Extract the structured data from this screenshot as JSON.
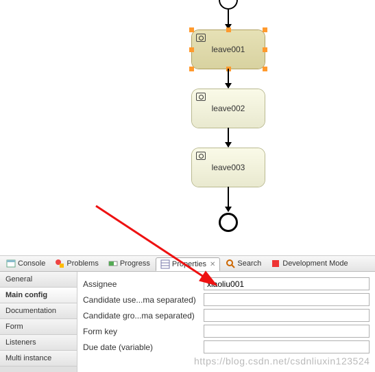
{
  "diagram": {
    "tasks": [
      {
        "label": "leave001",
        "selected": true
      },
      {
        "label": "leave002",
        "selected": false
      },
      {
        "label": "leave003",
        "selected": false
      }
    ]
  },
  "tabs": {
    "console": "Console",
    "problems": "Problems",
    "progress": "Progress",
    "properties": "Properties",
    "search": "Search",
    "devmode": "Development Mode"
  },
  "sideTabs": {
    "general": "General",
    "mainConfig": "Main config",
    "documentation": "Documentation",
    "form": "Form",
    "listeners": "Listeners",
    "multiInstance": "Multi instance"
  },
  "form": {
    "assignee_label": "Assignee",
    "assignee_value": "xiaoliu001",
    "candUsers_label": "Candidate use...ma separated)",
    "candUsers_value": "",
    "candGroups_label": "Candidate gro...ma separated)",
    "candGroups_value": "",
    "formKey_label": "Form key",
    "formKey_value": "",
    "dueDate_label": "Due date (variable)",
    "dueDate_value": ""
  },
  "watermark": "https://blog.csdn.net/csdnliuxin123524"
}
